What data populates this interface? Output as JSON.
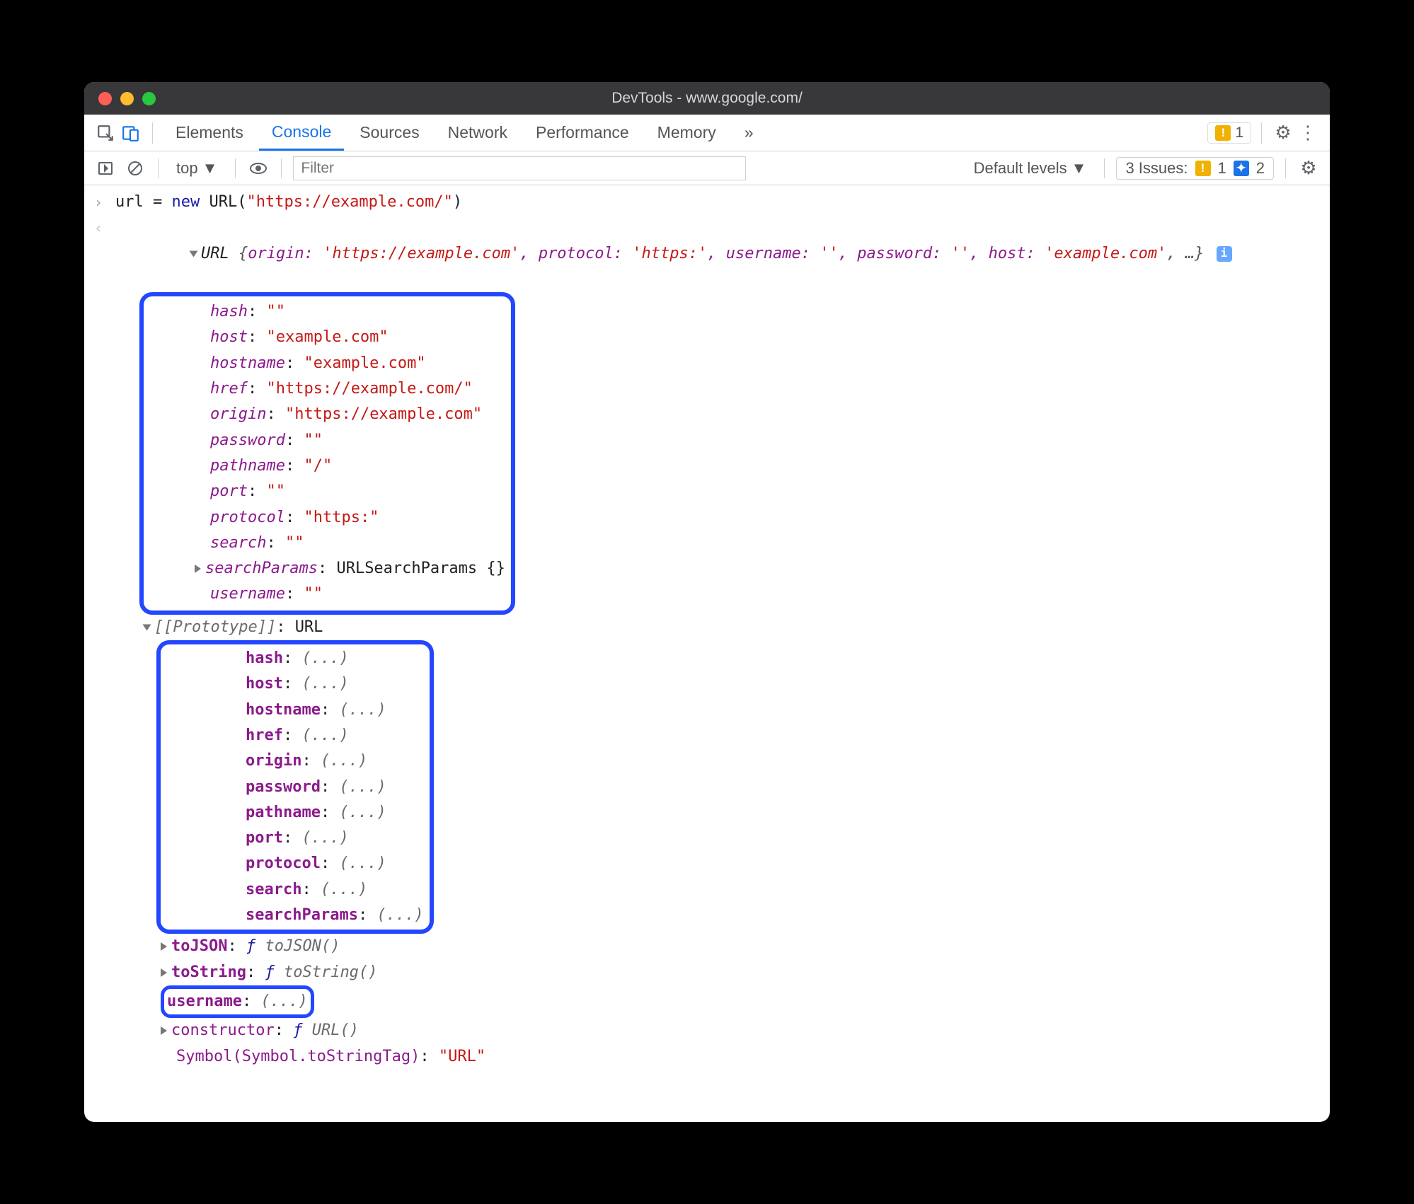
{
  "window": {
    "title": "DevTools - www.google.com/"
  },
  "tabs": {
    "elements": "Elements",
    "console": "Console",
    "sources": "Sources",
    "network": "Network",
    "performance": "Performance",
    "memory": "Memory",
    "more": "»",
    "warn_count": "1"
  },
  "toolbar": {
    "context": "top",
    "filter_placeholder": "Filter",
    "levels": "Default levels",
    "issues_label": "3 Issues:",
    "issues_warn": "1",
    "issues_msg": "2"
  },
  "input_line": {
    "var": "url",
    "eq": " = ",
    "new": "new",
    "cls": " URL(",
    "arg": "\"https://example.com/\"",
    "close": ")"
  },
  "summary": {
    "cls": "URL ",
    "open": "{",
    "origin_k": "origin:",
    "origin_v": " 'https://example.com'",
    "protocol_k": ", protocol:",
    "protocol_v": " 'https:'",
    "username_k": ", username:",
    "username_v": " ''",
    "password_k": ", password:",
    "password_v": " ''",
    "host_k": ", host:",
    "host_v": " 'example.com'",
    "tail": ", …}"
  },
  "props": {
    "hash_k": "hash",
    "hash_v": "\"\"",
    "host_k": "host",
    "host_v": "\"example.com\"",
    "hostname_k": "hostname",
    "hostname_v": "\"example.com\"",
    "href_k": "href",
    "href_v": "\"https://example.com/\"",
    "origin_k": "origin",
    "origin_v": "\"https://example.com\"",
    "password_k": "password",
    "password_v": "\"\"",
    "pathname_k": "pathname",
    "pathname_v": "\"/\"",
    "port_k": "port",
    "port_v": "\"\"",
    "protocol_k": "protocol",
    "protocol_v": "\"https:\"",
    "search_k": "search",
    "search_v": "\"\"",
    "searchParams_k": "searchParams",
    "searchParams_v": "URLSearchParams {}",
    "username_k": "username",
    "username_v": "\"\""
  },
  "proto": {
    "label": "[[Prototype]]",
    "cls": "URL",
    "hash": "hash",
    "host": "host",
    "hostname": "hostname",
    "href": "href",
    "origin": "origin",
    "password": "password",
    "pathname": "pathname",
    "port": "port",
    "protocol": "protocol",
    "search": "search",
    "searchParams": "searchParams",
    "ell": "(...)",
    "toJSON_k": "toJSON",
    "toJSON_v": "toJSON()",
    "toString_k": "toString",
    "toString_v": "toString()",
    "username": "username",
    "constructor_k": "constructor",
    "constructor_v": "URL()",
    "symbol_k": "Symbol(Symbol.toStringTag)",
    "symbol_v": "\"URL\"",
    "f": "ƒ"
  }
}
